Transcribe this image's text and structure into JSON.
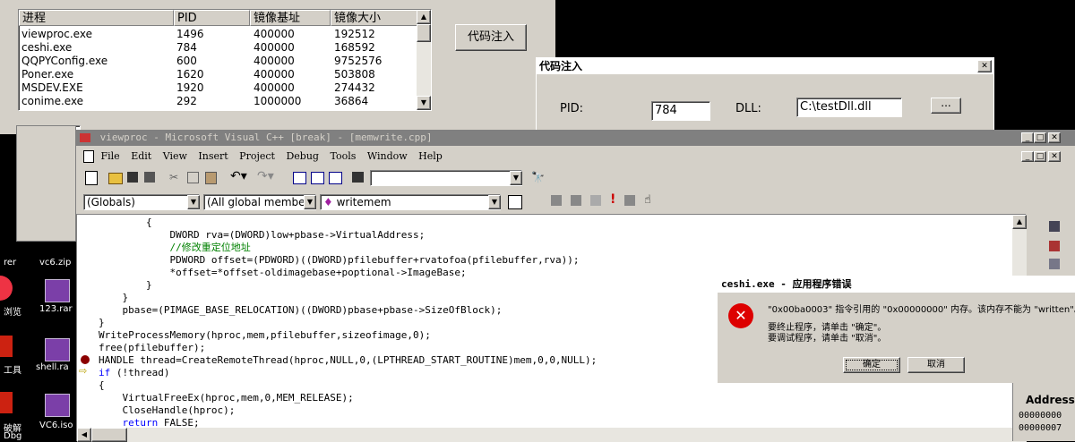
{
  "process_list": {
    "headers": [
      "进程",
      "PID",
      "镜像基址",
      "镜像大小"
    ],
    "rows": [
      [
        "viewproc.exe",
        "1496",
        "400000",
        "192512"
      ],
      [
        "ceshi.exe",
        "784",
        "400000",
        "168592"
      ],
      [
        "QQPYConfig.exe",
        "600",
        "400000",
        "9752576"
      ],
      [
        "Poner.exe",
        "1620",
        "400000",
        "503808"
      ],
      [
        "MSDEV.EXE",
        "1920",
        "400000",
        "274432"
      ],
      [
        "conime.exe",
        "292",
        "1000000",
        "36864"
      ]
    ]
  },
  "inject_button_label": "代码注入",
  "inject_dialog": {
    "title": "代码注入",
    "close": "✕",
    "pid_label": "PID:",
    "pid_value": "784",
    "dll_label": "DLL:",
    "dll_value": "C:\\testDll.dll",
    "browse_label": "..."
  },
  "vc_window": {
    "title": "viewproc - Microsoft Visual C++ [break] - [memwrite.cpp]",
    "menu": [
      "File",
      "Edit",
      "View",
      "Insert",
      "Project",
      "Debug",
      "Tools",
      "Window",
      "Help"
    ],
    "combo_globals": "(Globals)",
    "combo_members": "(All global members",
    "combo_function": "writemem",
    "code_lines": [
      {
        "indent": "        ",
        "text": "{",
        "type": "code"
      },
      {
        "indent": "            ",
        "text": "DWORD rva=(DWORD)low+pbase->VirtualAddress;",
        "type": "code"
      },
      {
        "indent": "            ",
        "text": "//修改重定位地址",
        "type": "comment"
      },
      {
        "indent": "            ",
        "text": "PDWORD offset=(PDWORD)((DWORD)pfilebuffer+rvatofoa(pfilebuffer,rva));",
        "type": "code"
      },
      {
        "indent": "            ",
        "text": "*offset=*offset-oldimagebase+poptional->ImageBase;",
        "type": "code"
      },
      {
        "indent": "        ",
        "text": "}",
        "type": "code"
      },
      {
        "indent": "    ",
        "text": "}",
        "type": "code"
      },
      {
        "indent": "    ",
        "text": "pbase=(PIMAGE_BASE_RELOCATION)((DWORD)pbase+pbase->SizeOfBlock);",
        "type": "code"
      },
      {
        "indent": "",
        "text": "}",
        "type": "code"
      },
      {
        "indent": "",
        "text": "WriteProcessMemory(hproc,mem,pfilebuffer,sizeofimage,0);",
        "type": "code"
      },
      {
        "indent": "",
        "text": "free(pfilebuffer);",
        "type": "code"
      },
      {
        "indent": "",
        "text": "HANDLE thread=CreateRemoteThread(hproc,NULL,0,(LPTHREAD_START_ROUTINE)mem,0,0,NULL);",
        "type": "code"
      },
      {
        "indent": "",
        "text": "if (!thread)",
        "type": "keyword_if"
      },
      {
        "indent": "",
        "text": "{",
        "type": "code"
      },
      {
        "indent": "    ",
        "text": "VirtualFreeEx(hproc,mem,0,MEM_RELEASE);",
        "type": "code"
      },
      {
        "indent": "    ",
        "text": "CloseHandle(hproc);",
        "type": "code"
      },
      {
        "indent": "    ",
        "text": "return FALSE;",
        "type": "keyword_return"
      }
    ]
  },
  "error_dialog": {
    "title": "ceshi.exe - 应用程序错误",
    "message1": "\"0x00ba0003\" 指令引用的 \"0x00000000\" 内存。该内存不能为 \"written\"。",
    "message2": "要终止程序，请单击 \"确定\"。",
    "message3": "要调试程序，请单击 \"取消\"。",
    "ok_label": "确定",
    "cancel_label": "取消"
  },
  "memory_panel": {
    "address_label": "Address:",
    "values": [
      "00000000",
      "00000007"
    ]
  },
  "desktop_icons": [
    {
      "label": "rer"
    },
    {
      "label": "vc6.zip"
    },
    {
      "label": "浏览"
    },
    {
      "label": "123.rar"
    },
    {
      "label": "工具"
    },
    {
      "label": "shell.ra"
    },
    {
      "label": "破解"
    },
    {
      "label": "VC6.iso"
    },
    {
      "label": "Dbg"
    }
  ]
}
